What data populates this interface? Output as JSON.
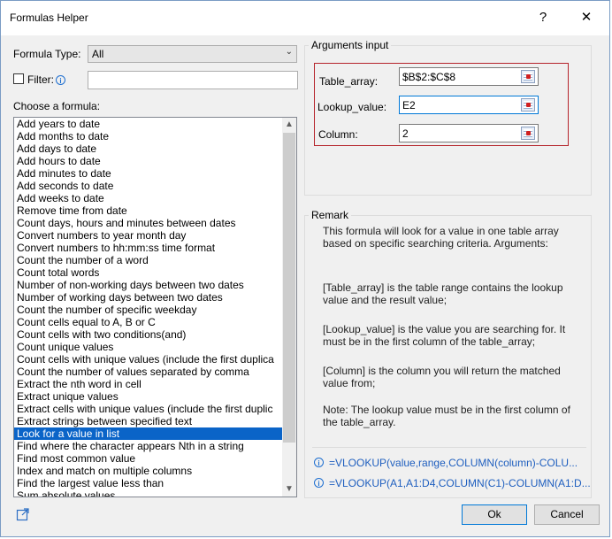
{
  "window": {
    "title": "Formulas Helper",
    "help_glyph": "?",
    "close_glyph": "✕"
  },
  "formula_type": {
    "label": "Formula Type:",
    "selected": "All"
  },
  "filter": {
    "label": "Filter:",
    "value": ""
  },
  "choose": {
    "label": "Choose a formula:",
    "items": [
      "Add years to date",
      "Add months to date",
      "Add days to date",
      "Add hours to date",
      "Add minutes to date",
      "Add seconds to date",
      "Add weeks to date",
      "Remove time from date",
      "Count days, hours and minutes between dates",
      "Convert numbers to year month day",
      "Convert numbers to hh:mm:ss time format",
      "Count the number of a word",
      "Count total words",
      "Number of non-working days between two dates",
      "Number of working days between two dates",
      "Count the number of specific weekday",
      "Count cells equal to A, B or C",
      "Count cells with two conditions(and)",
      "Count unique values",
      "Count cells with unique values (include the first duplica",
      "Count the number of values separated by comma",
      "Extract the nth word in cell",
      "Extract unique values",
      "Extract cells with unique values (include the first duplic",
      "Extract strings between specified text",
      "Look for a value in list",
      "Find where the character appears Nth in a string",
      "Find most common value",
      "Index and match on multiple columns",
      "Find the largest value less than",
      "Sum absolute values"
    ],
    "selected_index": 25
  },
  "arguments": {
    "title": "Arguments input",
    "table_array": {
      "label": "Table_array:",
      "value": "$B$2:$C$8"
    },
    "lookup_value": {
      "label": "Lookup_value:",
      "value": "E2"
    },
    "column": {
      "label": "Column:",
      "value": "2"
    }
  },
  "remark": {
    "title": "Remark",
    "p1": "This formula will look for a value in one table array based on specific searching criteria. Arguments:",
    "p2": "[Table_array] is the table range contains the lookup value and the result value;",
    "p3": "[Lookup_value] is the value you are searching for. It must be in the first column of the table_array;",
    "p4": "[Column] is the column you will return the matched value from;",
    "p5": "Note: The lookup value must be in the first column of the table_array.",
    "formula1": "=VLOOKUP(value,range,COLUMN(column)-COLU...",
    "formula2": "=VLOOKUP(A1,A1:D4,COLUMN(C1)-COLUMN(A1:D..."
  },
  "buttons": {
    "ok": "Ok",
    "cancel": "Cancel"
  },
  "colors": {
    "accent": "#0a64c8",
    "highlight_border": "#b5242b",
    "link": "#1f5fbf"
  },
  "icons": {
    "info": "i",
    "share": "external-link-icon"
  }
}
